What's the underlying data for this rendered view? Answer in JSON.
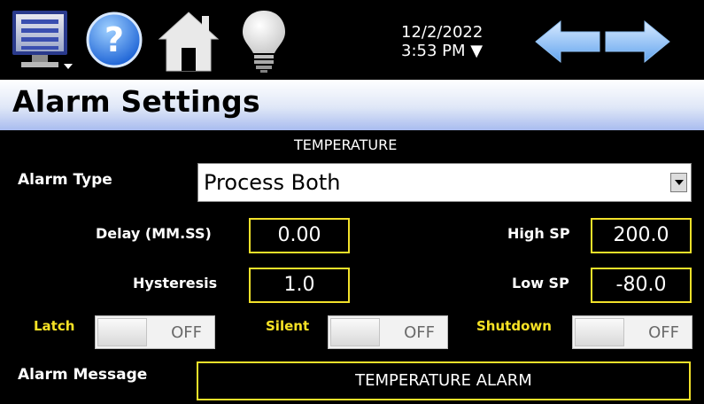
{
  "toolbar": {
    "icons": [
      "menu-monitor-icon",
      "help-icon",
      "home-icon",
      "lightbulb-icon",
      "back-arrow-icon",
      "forward-arrow-icon"
    ],
    "date": "12/2/2022",
    "time": "3:53 PM ▼"
  },
  "header": {
    "title": "Alarm Settings"
  },
  "section": {
    "title": "TEMPERATURE"
  },
  "alarm_type": {
    "label": "Alarm Type",
    "value": "Process Both"
  },
  "delay": {
    "label": "Delay (MM.SS)",
    "value": "0.00"
  },
  "hysteresis": {
    "label": "Hysteresis",
    "value": "1.0"
  },
  "high_sp": {
    "label": "High SP",
    "value": "200.0"
  },
  "low_sp": {
    "label": "Low SP",
    "value": "-80.0"
  },
  "latch": {
    "label": "Latch",
    "state": "OFF"
  },
  "silent": {
    "label": "Silent",
    "state": "OFF"
  },
  "shutdown": {
    "label": "Shutdown",
    "state": "OFF"
  },
  "alarm_message": {
    "label": "Alarm Message",
    "value": "TEMPERATURE ALARM"
  },
  "colors": {
    "accent_yellow": "#f2e12a",
    "header_blue": "#a9bcef",
    "background": "#000000"
  }
}
